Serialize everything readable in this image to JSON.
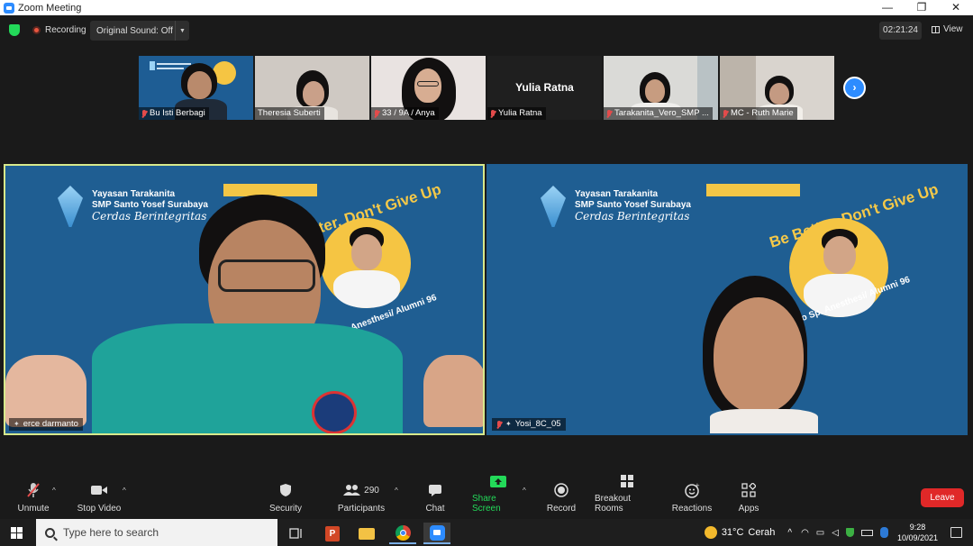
{
  "window": {
    "title": "Zoom Meeting",
    "controls": [
      "—",
      "❐",
      "✕"
    ]
  },
  "topbar": {
    "recording_label": "Recording",
    "sound_label": "Original Sound: Off",
    "timer": "02:21:24",
    "view_label": "View"
  },
  "participants_strip": [
    {
      "name": "Bu Isti Berbagi",
      "muted": true
    },
    {
      "name": "Theresia Suberti",
      "muted": false
    },
    {
      "name": "33 / 9A / Anya",
      "muted": true
    },
    {
      "name": "Yulia Ratna",
      "muted": true,
      "display_text": "Yulia Ratna"
    },
    {
      "name": "Tarakanita_Vero_SMP ...",
      "muted": true
    },
    {
      "name": "MC - Ruth Marie",
      "muted": true
    }
  ],
  "banner": {
    "org": "Yayasan Tarakanita",
    "school": "SMP Santo Yosef Surabaya",
    "motto": "Cerdas Berintegritas",
    "slogan_left": "etter, Don't Give Up",
    "slogan_right": "Be Better, Don't Give Up",
    "arc_left": "anto Sp. Anesthesi/ Alumni 96",
    "arc_right": "Dr. E... nto Sp. Anesthesi/ Alumni 96"
  },
  "main_videos": [
    {
      "name": "erce darmanto",
      "active_speaker": true
    },
    {
      "name": "Yosi_8C_05",
      "muted": true
    }
  ],
  "toolbar": {
    "unmute": "Unmute",
    "stop_video": "Stop Video",
    "security": "Security",
    "participants": "Participants",
    "participants_count": "290",
    "chat": "Chat",
    "share_screen": "Share Screen",
    "record": "Record",
    "breakout": "Breakout Rooms",
    "reactions": "Reactions",
    "apps": "Apps",
    "leave": "Leave"
  },
  "taskbar": {
    "search_placeholder": "Type here to search",
    "weather_temp": "31°C",
    "weather_desc": "Cerah",
    "time": "9:28",
    "date": "10/09/2021"
  },
  "colors": {
    "zoom_blue": "#2d8cff",
    "share_green": "#23d959",
    "leave_red": "#e02828",
    "banner_blue": "#1f5e92",
    "active_border": "#d7e98c"
  }
}
